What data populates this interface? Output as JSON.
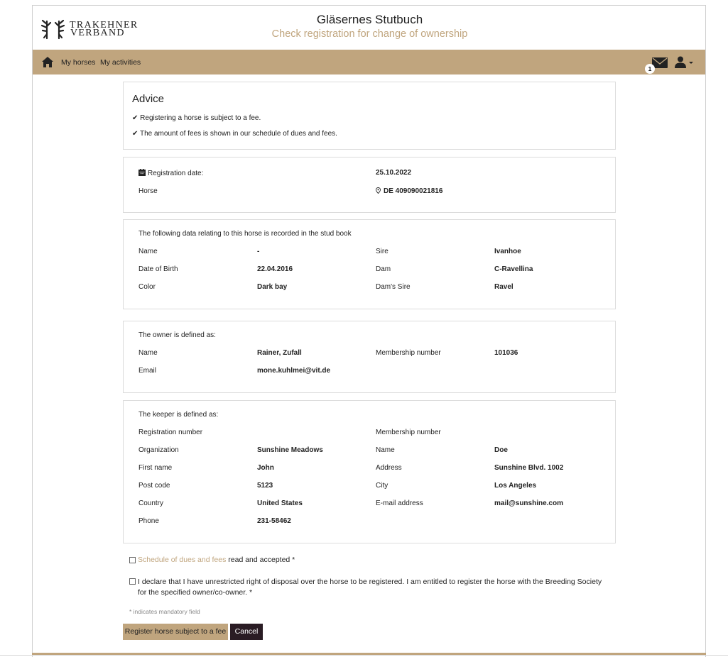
{
  "header": {
    "logo_line1": "TRAKEHNER",
    "logo_line2": "VERBAND",
    "title": "Gläsernes Stutbuch",
    "subtitle": "Check registration for change of ownership"
  },
  "nav": {
    "my_horses": "My horses",
    "my_activities": "My activities",
    "mail_badge": "1"
  },
  "advice": {
    "title": "Advice",
    "line1": "✔ Registering a horse is subject to a fee.",
    "line2": "✔ The amount of fees is shown in our schedule of dues and fees."
  },
  "registration": {
    "date_label": "Registration date:",
    "date_value": "25.10.2022",
    "horse_label": "Horse",
    "horse_value": "DE 409090021816"
  },
  "stud_book": {
    "heading": "The following data relating to this horse is recorded in the stud book",
    "name_label": "Name",
    "name_value": "-",
    "dob_label": "Date of Birth",
    "dob_value": "22.04.2016",
    "color_label": "Color",
    "color_value": "Dark bay",
    "sire_label": "Sire",
    "sire_value": "Ivanhoe",
    "dam_label": "Dam",
    "dam_value": "C-Ravellina",
    "dams_sire_label": "Dam's Sire",
    "dams_sire_value": "Ravel"
  },
  "owner": {
    "heading": "The owner is defined as:",
    "name_label": "Name",
    "name_value": "Rainer, Zufall",
    "email_label": "Email",
    "email_value": "mone.kuhlmei@vit.de",
    "membership_label": "Membership number",
    "membership_value": "101036"
  },
  "keeper": {
    "heading": "The keeper is defined as:",
    "reg_number_label": "Registration number",
    "membership_label": "Membership number",
    "org_label": "Organization",
    "org_value": "Sunshine Meadows",
    "name_label": "Name",
    "name_value": "Doe",
    "first_name_label": "First name",
    "first_name_value": "John",
    "address_label": "Address",
    "address_value": "Sunshine Blvd. 1002",
    "post_code_label": "Post code",
    "post_code_value": "5123",
    "city_label": "City",
    "city_value": "Los Angeles",
    "country_label": "Country",
    "country_value": "United States",
    "email_label": "E-mail address",
    "email_value": "mail@sunshine.com",
    "phone_label": "Phone",
    "phone_value": "231-58462"
  },
  "form": {
    "fees_link": "Schedule of dues and fees",
    "fees_suffix": " read and accepted *",
    "declaration": "I declare that I have unrestricted right of disposal over the horse to be registered. I am entitled to register the horse with the Breeding Society for the specified owner/co-owner. *",
    "mandatory_note": "* indicates mandatory field",
    "register_button": "Register horse subject to a fee",
    "cancel_button": "Cancel"
  },
  "colors": {
    "accent": "#c0a57e",
    "dark_button": "#2a1c24"
  }
}
